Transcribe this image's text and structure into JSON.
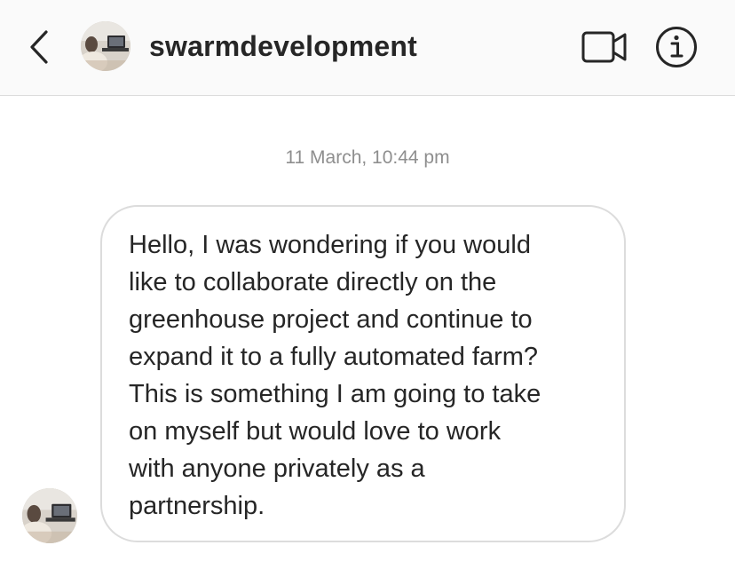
{
  "header": {
    "username": "swarmdevelopment",
    "back_icon": "chevron-left-icon",
    "video_icon": "video-call-icon",
    "info_icon": "info-icon"
  },
  "conversation": {
    "timestamp": "11 March, 10:44 pm",
    "message_lines": [
      "Hello, I was wondering if you would",
      "like to collaborate directly on the",
      "greenhouse project and continue to",
      "expand it to a fully automated farm?",
      "This is something I am going to take",
      "on myself but would love to work",
      "with anyone privately as a",
      "partnership."
    ]
  },
  "colors": {
    "header_bg": "#fafafa",
    "text": "#262626",
    "timestamp": "#8e8e8e",
    "bubble_border": "#dcdcdc"
  }
}
